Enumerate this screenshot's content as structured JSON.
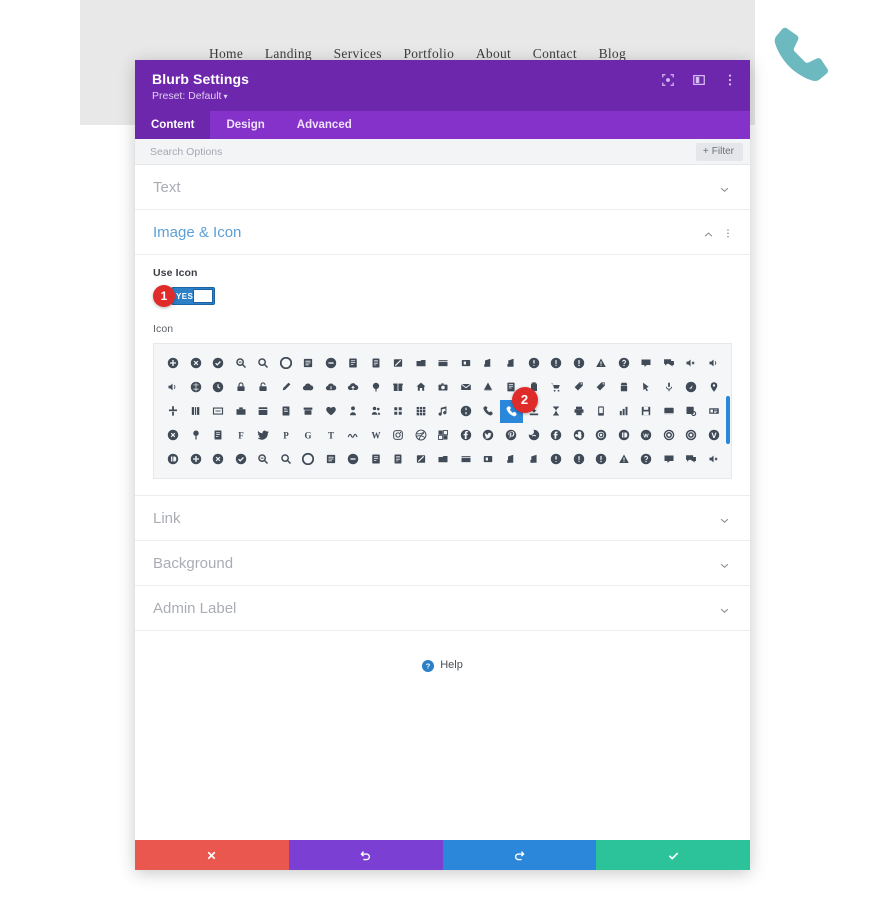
{
  "site": {
    "nav_items": [
      "Home",
      "Landing",
      "Services",
      "Portfolio",
      "About",
      "Contact",
      "Blog"
    ],
    "phone_graphic_icon": "phone-icon",
    "phone_graphic_color": "#6cb9c0",
    "band_color": "#e8e8e8"
  },
  "modal": {
    "title": "Blurb Settings",
    "preset_label": "Preset: Default",
    "preset_caret": "▾",
    "header_icons": [
      "expand-icon",
      "layout-panel-icon",
      "more-vertical-icon"
    ],
    "header_color": "#6d27ad",
    "tabs": [
      {
        "label": "Content",
        "active": true
      },
      {
        "label": "Design",
        "active": false
      },
      {
        "label": "Advanced",
        "active": false
      }
    ],
    "search": {
      "placeholder": "Search Options",
      "value": "",
      "filter_label": "Filter",
      "filter_plus": "+"
    },
    "sections": [
      {
        "label": "Text",
        "open": false
      },
      {
        "label": "Image & Icon",
        "open": true
      },
      {
        "label": "Link",
        "open": false
      },
      {
        "label": "Background",
        "open": false
      },
      {
        "label": "Admin Label",
        "open": false
      }
    ],
    "image_icon_section": {
      "use_icon_label": "Use Icon",
      "toggle_value": "YES",
      "toggle_on": true,
      "toggle_color": "#2b80c8",
      "icon_label": "Icon",
      "selected_icon": "phone-icon",
      "selected_index": 65,
      "selected_highlight_color": "#2b87da",
      "grid_columns": 25,
      "grid_rows_visible": 5,
      "scrollbar_color": "#2b87da"
    },
    "help": {
      "label": "Help",
      "icon": "question-circle-icon"
    },
    "footer_buttons": [
      {
        "name": "cancel-button",
        "icon": "close-icon",
        "color": "#e9574e"
      },
      {
        "name": "undo-button",
        "icon": "undo-icon",
        "color": "#7b3fd4"
      },
      {
        "name": "redo-button",
        "icon": "redo-icon",
        "color": "#2b87da"
      },
      {
        "name": "save-button",
        "icon": "check-icon",
        "color": "#2cc29a"
      }
    ]
  },
  "annotations": [
    {
      "number": "1",
      "target": "use-icon-toggle"
    },
    {
      "number": "2",
      "target": "selected-phone-icon"
    }
  ]
}
